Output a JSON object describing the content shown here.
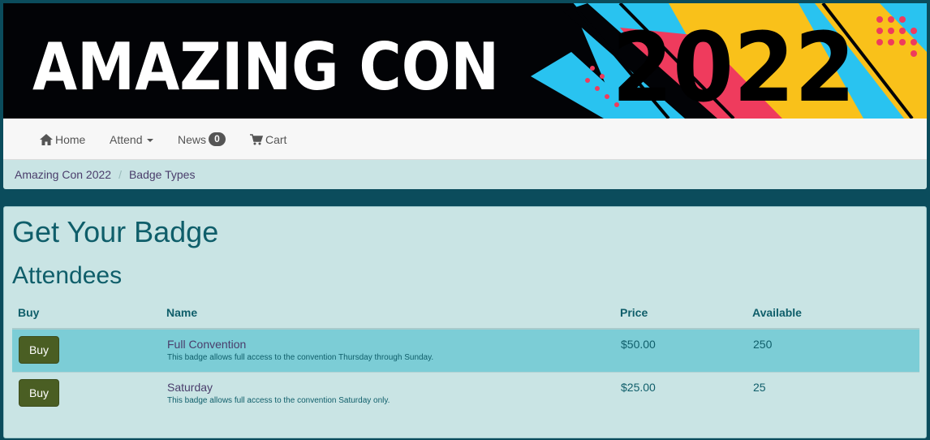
{
  "banner": {
    "title_text": "AMAZING CON",
    "year_text": "2022",
    "colors": {
      "background": "#020306",
      "blue": "#29c3f0",
      "yellow": "#f9c11a",
      "pink": "#ef3b5d",
      "title": "#ffffff"
    }
  },
  "nav": {
    "items": [
      {
        "label": "Home",
        "icon": "home-icon"
      },
      {
        "label": "Attend",
        "icon": "chevron-down-icon"
      },
      {
        "label": "News",
        "count": "0"
      },
      {
        "label": "Cart",
        "icon": "cart-icon"
      }
    ]
  },
  "breadcrumb": {
    "items": [
      "Amazing Con 2022",
      "Badge Types"
    ],
    "separator": "/"
  },
  "main": {
    "title": "Get Your Badge",
    "section": "Attendees",
    "table": {
      "headers": [
        "Buy",
        "Name",
        "Price",
        "Available"
      ],
      "rows": [
        {
          "button": "Buy",
          "name": "Full Convention",
          "description": "This badge allows full access to the convention Thursday through Sunday.",
          "price": "$50.00",
          "available": "250"
        },
        {
          "button": "Buy",
          "name": "Saturday",
          "description": "This badge allows full access to the convention Saturday only.",
          "price": "$25.00",
          "available": "25"
        }
      ]
    }
  },
  "colors": {
    "page_background": "#0b4c5c",
    "panel_background": "#c9e4e4",
    "row_highlight": "#7ccdd6",
    "button": "#4a5e23",
    "heading": "#0f5e6a"
  }
}
